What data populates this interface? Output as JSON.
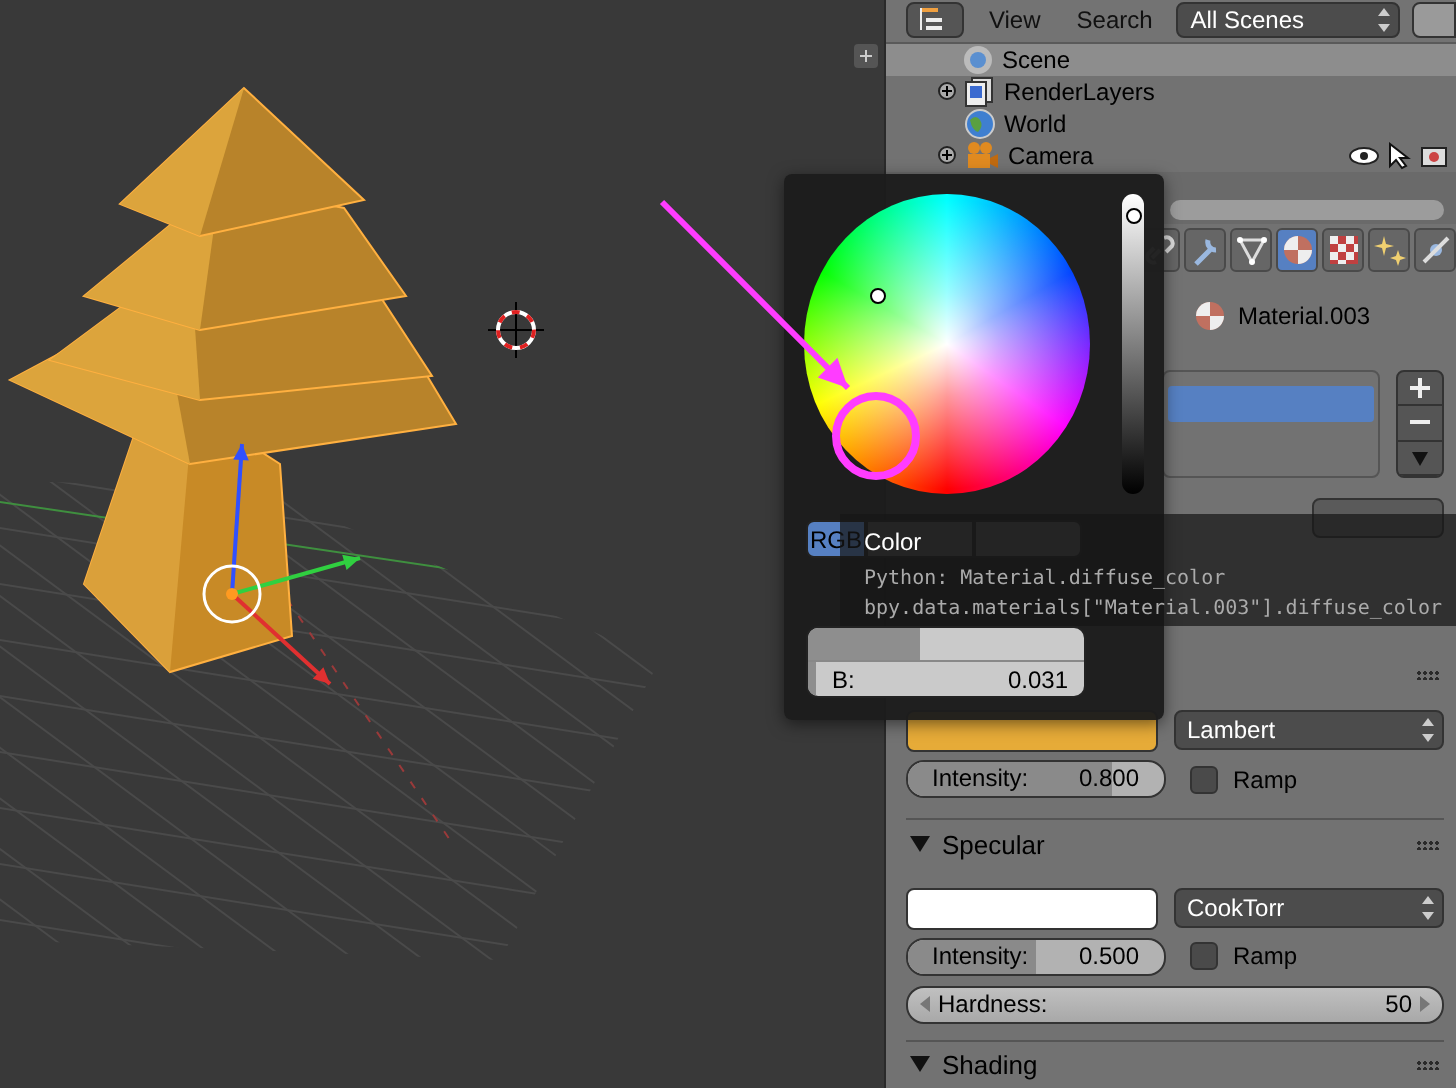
{
  "outliner_header": {
    "view_menu": "View",
    "search_menu": "Search",
    "filter": "All Scenes"
  },
  "outliner": [
    {
      "label": "Scene",
      "kind": "scene",
      "collapsed": false,
      "children": [
        {
          "label": "RenderLayers",
          "kind": "render-layers",
          "collapsed": true
        },
        {
          "label": "World",
          "kind": "world",
          "collapsed": false
        },
        {
          "label": "Camera",
          "kind": "camera",
          "collapsed": true
        }
      ]
    }
  ],
  "property_tabs": [
    {
      "kind": "constraints",
      "selected": false
    },
    {
      "kind": "modifiers",
      "selected": false
    },
    {
      "kind": "data",
      "selected": false
    },
    {
      "kind": "material",
      "selected": true
    },
    {
      "kind": "texture",
      "selected": false
    },
    {
      "kind": "particles",
      "selected": false
    },
    {
      "kind": "physics",
      "selected": false
    }
  ],
  "material": {
    "name": "Material.003",
    "slots": [
      {
        "selected": true
      }
    ]
  },
  "diffuse": {
    "color": "#e6ab38",
    "shader": "Lambert",
    "intensity": {
      "label": "Intensity:",
      "reading": "0.800",
      "level": 0.8
    },
    "ramp": {
      "label": "Ramp",
      "checked": false
    }
  },
  "specular": {
    "title": "Specular",
    "expanded": true,
    "color": "#ffffff",
    "shader": "CookTorr",
    "intensity": {
      "label": "Intensity:",
      "reading": "0.500",
      "level": 0.5
    },
    "ramp": {
      "label": "Ramp",
      "checked": false
    },
    "hardness": {
      "label": "Hardness:",
      "reading": "50"
    }
  },
  "shading": {
    "title": "Shading",
    "expanded": true
  },
  "color_picker": {
    "value_slider": {
      "level": 0.95
    },
    "modes": [
      {
        "label": "RGB",
        "selected": true
      },
      {
        "selected": false
      },
      {
        "selected": false
      }
    ],
    "channels": [
      {
        "level": 0.408
      },
      {
        "label": "B:",
        "reading": "0.031",
        "level": 0.031
      }
    ]
  },
  "tooltip": {
    "title": "Color",
    "lines": [
      "Python: Material.diffuse_color",
      "bpy.data.materials[\"Material.003\"].diffuse_color"
    ]
  }
}
